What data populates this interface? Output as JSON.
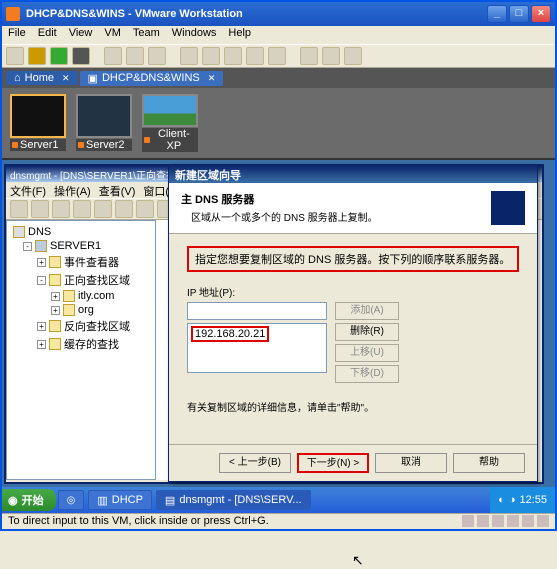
{
  "vmware": {
    "title": "DHCP&DNS&WINS - VMware Workstation",
    "menu": [
      "File",
      "Edit",
      "View",
      "VM",
      "Team",
      "Windows",
      "Help"
    ],
    "tabs": {
      "home": "Home",
      "active": "DHCP&DNS&WINS"
    },
    "thumbs": [
      {
        "label": "Server1"
      },
      {
        "label": "Server2"
      },
      {
        "label": "Client-XP"
      }
    ],
    "status": "To direct input to this VM, click inside or press Ctrl+G."
  },
  "mmc": {
    "title": "dnsmgmt - [DNS\\SERVER1\\正向查找...]",
    "menu": [
      "文件(F)",
      "操作(A)",
      "查看(V)",
      "窗口(W)"
    ],
    "tree": {
      "root": "DNS",
      "server": "SERVER1",
      "items": [
        {
          "label": "事件查看器",
          "exp": "+"
        },
        {
          "label": "正向查找区域",
          "exp": "-",
          "children": [
            "itly.com",
            "org"
          ]
        },
        {
          "label": "反向查找区域",
          "exp": "+"
        },
        {
          "label": "缓存的查找",
          "exp": "+"
        }
      ]
    }
  },
  "wizard": {
    "title": "新建区域向导",
    "heading": "主 DNS 服务器",
    "subtitle": "区域从一个或多个的 DNS 服务器上复制。",
    "instruction": "指定您想要复制区域的 DNS 服务器。按下列的顺序联系服务器。",
    "ip_label": "IP 地址(P):",
    "ip_value": "192.168.20.21",
    "btn_add": "添加(A)",
    "btn_remove": "删除(R)",
    "btn_up": "上移(U)",
    "btn_down": "下移(D)",
    "note": "有关复制区域的详细信息，请单击\"帮助\"。",
    "btn_back": "< 上一步(B)",
    "btn_next": "下一步(N) >",
    "btn_cancel": "取消",
    "btn_help": "帮助"
  },
  "guest_taskbar": {
    "start": "开始",
    "items": [
      "DHCP",
      "dnsmgmt - [DNS\\SERV..."
    ],
    "clock": "12:55"
  }
}
